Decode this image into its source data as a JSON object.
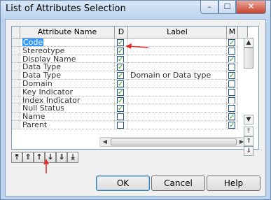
{
  "window": {
    "title": "List of Attributes Selection"
  },
  "columns": [
    "Attribute Name",
    "D",
    "Label",
    "M"
  ],
  "rows": [
    {
      "name": "Code",
      "d": true,
      "label": "",
      "m": true,
      "selected": true
    },
    {
      "name": "Stereotype",
      "d": true,
      "label": "",
      "m": false
    },
    {
      "name": "Display Name",
      "d": true,
      "label": "",
      "m": true
    },
    {
      "name": "Data Type",
      "d": true,
      "label": "",
      "m": false
    },
    {
      "name": "Data Type",
      "d": true,
      "label": "Domain or Data type",
      "m": true
    },
    {
      "name": "Domain",
      "d": true,
      "label": "",
      "m": false
    },
    {
      "name": "Key Indicator",
      "d": true,
      "label": "",
      "m": false
    },
    {
      "name": "Index Indicator",
      "d": true,
      "label": "",
      "m": false
    },
    {
      "name": "Null Status",
      "d": true,
      "label": "",
      "m": false
    },
    {
      "name": "Name",
      "d": false,
      "label": "",
      "m": true
    },
    {
      "name": "Parent",
      "d": false,
      "label": "",
      "m": true
    }
  ],
  "buttons": {
    "ok": "OK",
    "cancel": "Cancel",
    "help": "Help"
  },
  "caption": {
    "minimize": "–",
    "maximize": "☐",
    "close": "✕"
  },
  "move_buttons": [
    "⤒",
    "⇑",
    "↑",
    "↓",
    "⇓",
    "⤓"
  ],
  "colors": {
    "selection": "#3399ff",
    "check": "#21a121",
    "annotation": "#e53030"
  }
}
